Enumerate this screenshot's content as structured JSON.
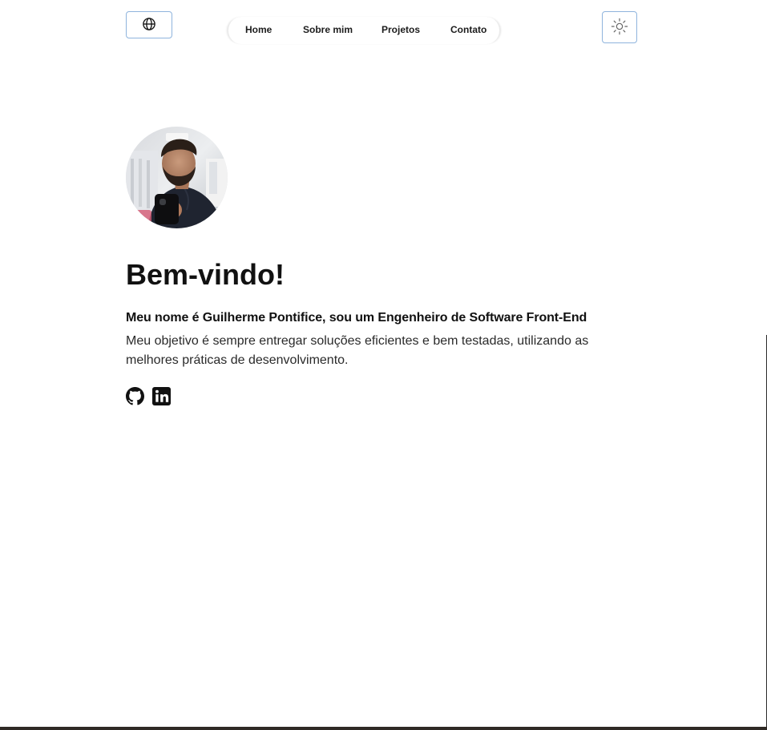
{
  "header": {
    "language_button": {
      "icon": "globe-icon"
    },
    "nav": {
      "items": [
        {
          "label": "Home"
        },
        {
          "label": "Sobre mim"
        },
        {
          "label": "Projetos"
        },
        {
          "label": "Contato"
        }
      ]
    },
    "theme_button": {
      "icon": "sun-icon"
    }
  },
  "hero": {
    "avatar_alt": "Foto de Guilherme Pontifice",
    "title": "Bem-vindo!",
    "subtitle": "Meu nome é Guilherme Pontifice, sou um Engenheiro de Software Front-End",
    "description": "Meu objetivo é sempre entregar soluções eficientes e bem testadas, utilizando as melhores práticas de desenvolvimento.",
    "social": [
      {
        "icon": "github-icon"
      },
      {
        "icon": "linkedin-icon"
      }
    ]
  },
  "colors": {
    "button_border": "#8fb4dd",
    "text": "#111111",
    "background": "#ffffff"
  }
}
